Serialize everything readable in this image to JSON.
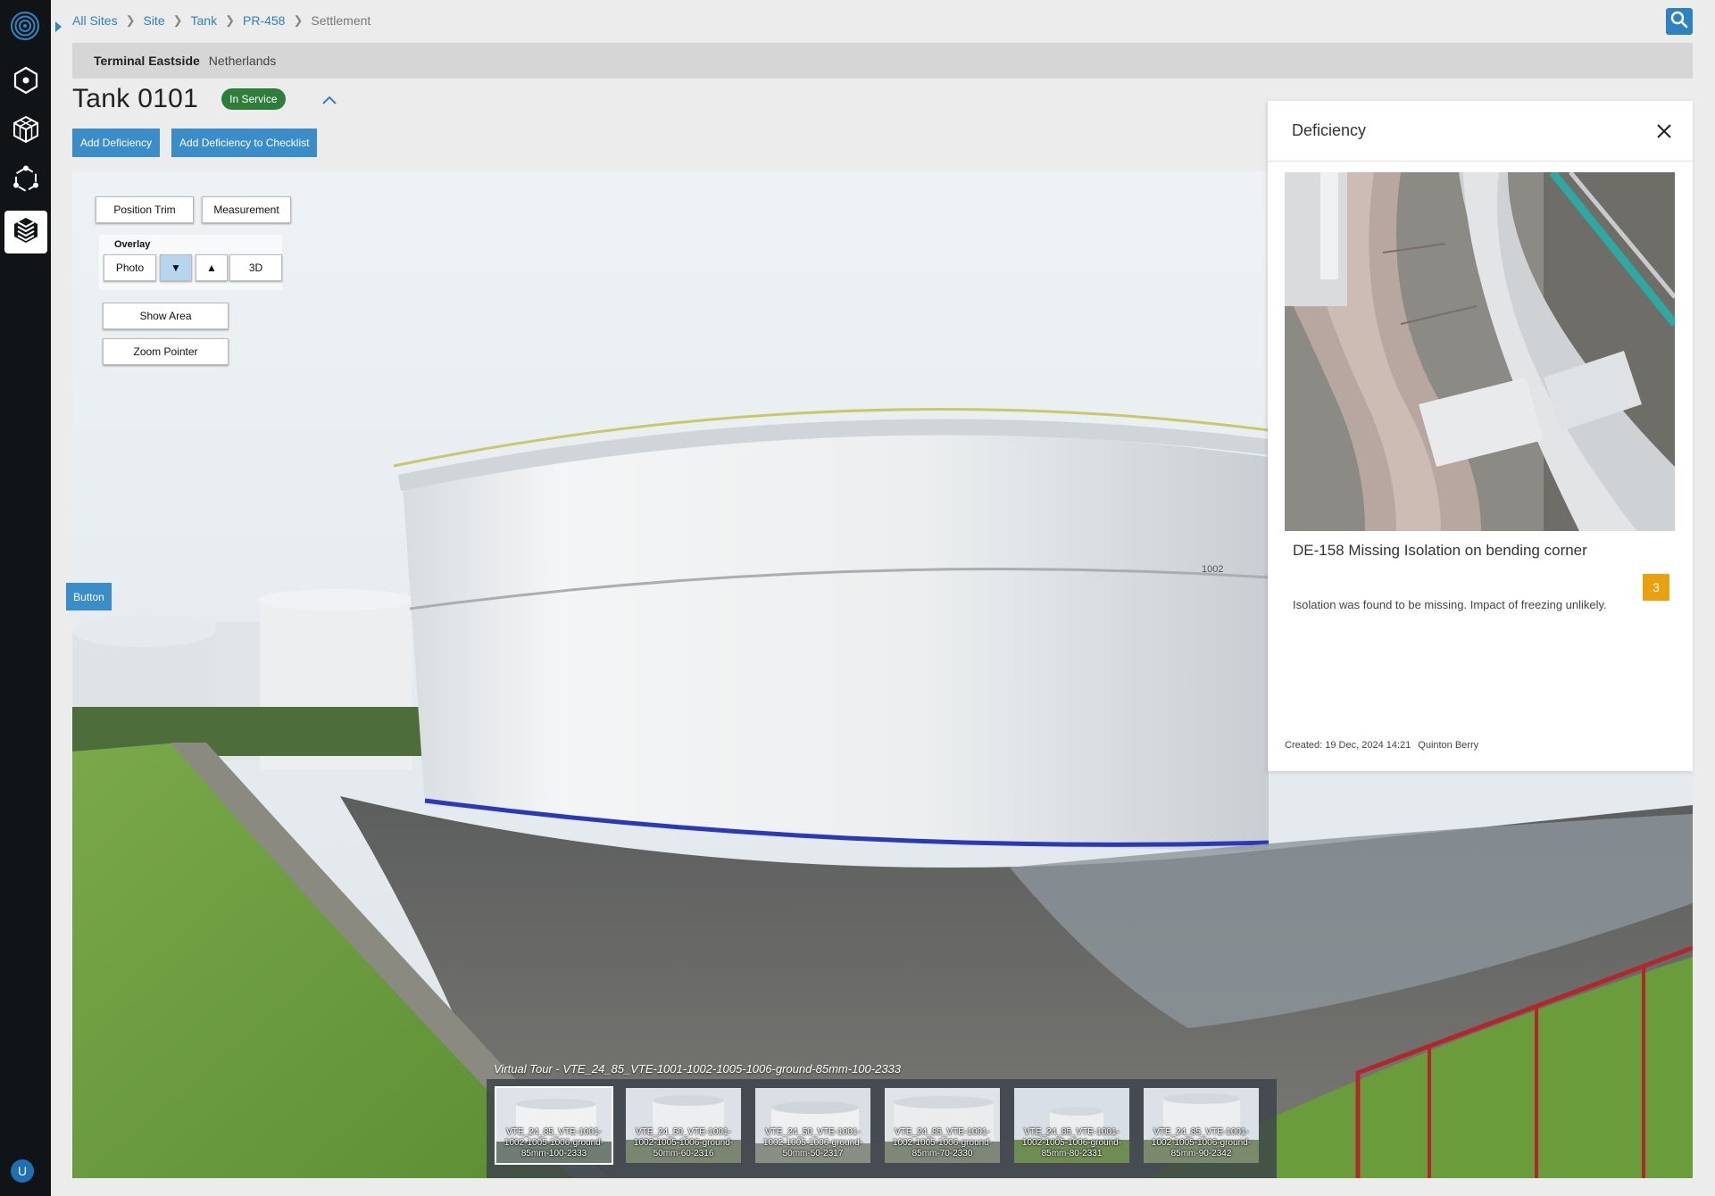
{
  "breadcrumb": {
    "items": [
      "All Sites",
      "Site",
      "Tank",
      "PR-458"
    ],
    "current": "Settlement"
  },
  "site": {
    "name": "Terminal Eastside",
    "country": "Netherlands"
  },
  "asset": {
    "title": "Tank 0101",
    "status": "In Service"
  },
  "actions": {
    "add_deficiency": "Add Deficiency",
    "add_to_checklist": "Add Deficiency to Checklist"
  },
  "viewer": {
    "position_trim": "Position Trim",
    "measurement": "Measurement",
    "overlay_label": "Overlay",
    "overlay_photo": "Photo",
    "overlay_down": "▼",
    "overlay_up": "▲",
    "overlay_3d": "3D",
    "show_area": "Show Area",
    "zoom_pointer": "Zoom Pointer",
    "side_button": "Button",
    "tank_marking": "1002"
  },
  "tour": {
    "caption": "Virtual Tour - VTE_24_85_VTE-1001-1002-1005-1006-ground-85mm-100-2333",
    "thumbnails": [
      {
        "line1": "VTE_24_85_VTE-1001-",
        "line2": "1002-1005-1006-ground-",
        "line3": "85mm-100-2333"
      },
      {
        "line1": "VTE_24_50_VTE-1001-",
        "line2": "1002-1005-1006-ground-",
        "line3": "50mm-60-2316"
      },
      {
        "line1": "VTE_24_50_VTE-1001-",
        "line2": "1002-1005-1006-ground-",
        "line3": "50mm-50-2317"
      },
      {
        "line1": "VTE_24_85_VTE-1001-",
        "line2": "1002-1005-1006-ground-",
        "line3": "85mm-70-2330"
      },
      {
        "line1": "VTE_24_85_VTE-1001-",
        "line2": "1002-1005-1006-ground-",
        "line3": "85mm-80-2331"
      },
      {
        "line1": "VTE_24_85_VTE-1001-",
        "line2": "1002-1005-1006-ground-",
        "line3": "85mm-90-2342"
      }
    ]
  },
  "deficiency": {
    "panel_title": "Deficiency",
    "title": "DE-158 Missing Isolation on bending corner",
    "count": "3",
    "description": "Isolation was found to be missing. Impact of freezing unlikely.",
    "created_label": "Created: 19 Dec, 2024 14:21",
    "author": "Quinton Berry"
  },
  "user": {
    "initial": "U"
  },
  "colors": {
    "accent": "#3b8dc9",
    "status_green": "#2e7d3b",
    "badge_orange": "#e9a10f",
    "rail": "#111417"
  },
  "icons": [
    "logo-icon",
    "hexagon-icon",
    "cube-icon",
    "network-icon",
    "layers-icon",
    "search-icon",
    "chevron-up-icon",
    "close-icon"
  ]
}
